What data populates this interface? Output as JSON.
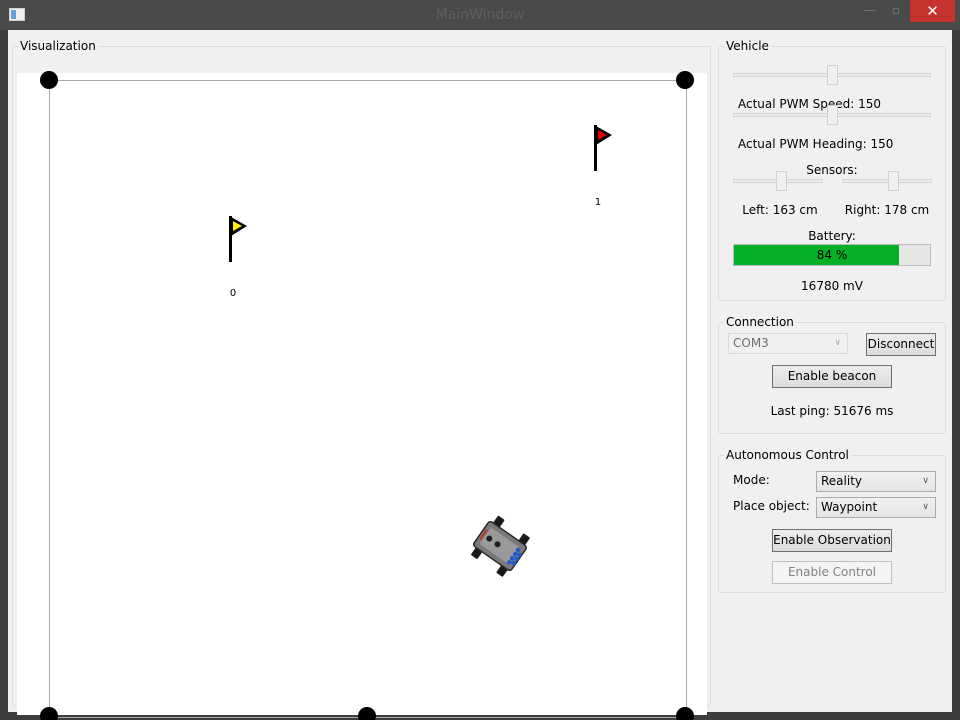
{
  "window": {
    "title": "MainWindow",
    "minimize_glyph": "—",
    "maximize_glyph": "▫",
    "close_glyph": "✕"
  },
  "visualization": {
    "legend": "Visualization",
    "waypoints": [
      {
        "label": "0",
        "color": "#ffee00"
      },
      {
        "label": "1",
        "color": "#e00000"
      }
    ],
    "boundary_color": "#a9a9a9"
  },
  "vehicle": {
    "legend": "Vehicle",
    "pwm_speed_text": "Actual PWM Speed: 150",
    "pwm_heading_text": "Actual PWM Heading: 150",
    "pwm_speed_level": 0.5,
    "pwm_heading_level": 0.5,
    "sensors_label": "Sensors:",
    "left_sensor_text": "Left: 163 cm",
    "right_sensor_text": "Right: 178 cm",
    "battery_label": "Battery:",
    "battery_percent": 84,
    "battery_text": "84 %",
    "battery_mv_text": "16780 mV",
    "battery_color": "#06b025"
  },
  "connection": {
    "legend": "Connection",
    "port_value": "COM3",
    "disconnect_label": "Disconnect",
    "beacon_label": "Enable beacon",
    "last_ping_text": "Last ping: 51676 ms"
  },
  "autonomous": {
    "legend": "Autonomous Control",
    "mode_label": "Mode:",
    "mode_value": "Reality",
    "place_label": "Place object:",
    "place_value": "Waypoint",
    "observation_label": "Enable Observation",
    "control_label": "Enable Control"
  }
}
